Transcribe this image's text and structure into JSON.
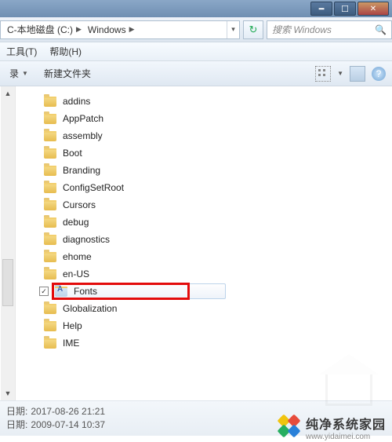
{
  "titlebar": {},
  "address": {
    "segments": [
      {
        "label": "C-本地磁盘 (C:)"
      },
      {
        "label": "Windows"
      }
    ]
  },
  "search": {
    "placeholder": "搜索 Windows"
  },
  "menubar": {
    "tools": "工具(T)",
    "help": "帮助(H)"
  },
  "toolbar": {
    "organize": "录",
    "newfolder": "新建文件夹"
  },
  "folders": [
    {
      "name": "addins",
      "special": false,
      "selected": false
    },
    {
      "name": "AppPatch",
      "special": false,
      "selected": false
    },
    {
      "name": "assembly",
      "special": false,
      "selected": false
    },
    {
      "name": "Boot",
      "special": false,
      "selected": false
    },
    {
      "name": "Branding",
      "special": false,
      "selected": false
    },
    {
      "name": "ConfigSetRoot",
      "special": false,
      "selected": false
    },
    {
      "name": "Cursors",
      "special": false,
      "selected": false
    },
    {
      "name": "debug",
      "special": false,
      "selected": false
    },
    {
      "name": "diagnostics",
      "special": false,
      "selected": false
    },
    {
      "name": "ehome",
      "special": false,
      "selected": false
    },
    {
      "name": "en-US",
      "special": false,
      "selected": false
    },
    {
      "name": "Fonts",
      "special": true,
      "selected": true
    },
    {
      "name": "Globalization",
      "special": false,
      "selected": false
    },
    {
      "name": "Help",
      "special": false,
      "selected": false
    },
    {
      "name": "IME",
      "special": false,
      "selected": false
    }
  ],
  "details": {
    "row1_key": "日期:",
    "row1_val": "2017-08-26 21:21",
    "row2_key": "日期:",
    "row2_val": "2009-07-14 10:37"
  },
  "watermark": {
    "line1": "纯净系统家园",
    "line2": "www.yidaimei.com"
  }
}
